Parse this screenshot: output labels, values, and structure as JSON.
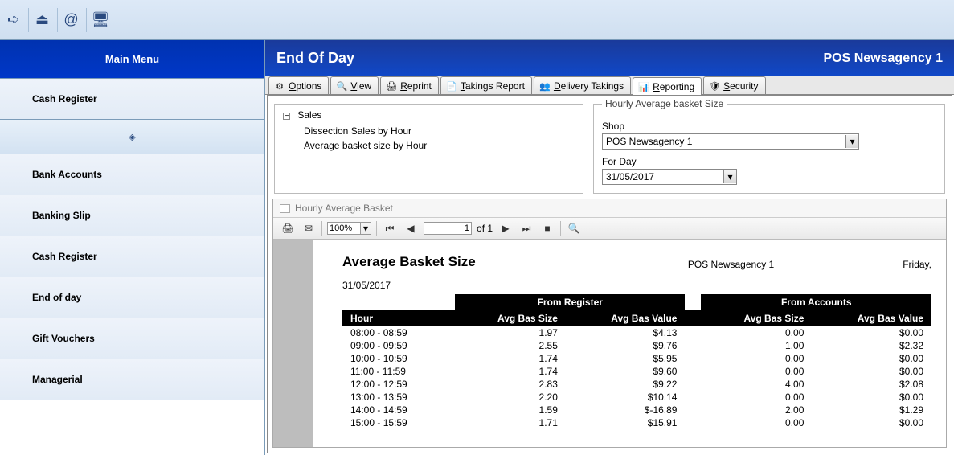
{
  "sidebar": {
    "header": "Main Menu",
    "items": [
      "Cash Register",
      "Bank Accounts",
      "Banking Slip",
      "Cash Register",
      "End of day",
      "Gift Vouchers",
      "Managerial"
    ],
    "sub_icon_name": "diamond-icon"
  },
  "page": {
    "title": "End Of Day",
    "subtitle": "POS Newsagency 1"
  },
  "tabs": [
    {
      "label": "Options"
    },
    {
      "label": "View"
    },
    {
      "label": "Reprint"
    },
    {
      "label": "Takings Report"
    },
    {
      "label": "Delivery Takings"
    },
    {
      "label": "Reporting",
      "active": true
    },
    {
      "label": "Security"
    }
  ],
  "tree": {
    "root": "Sales",
    "children": [
      "Dissection Sales by Hour",
      "Average basket size by Hour"
    ]
  },
  "filter": {
    "legend": "Hourly Average basket Size",
    "shop_label": "Shop",
    "shop_value": "POS Newsagency 1",
    "day_label": "For Day",
    "day_value": "31/05/2017"
  },
  "report": {
    "window_title": "Hourly Average Basket",
    "zoom": "100%",
    "page_current": "1",
    "page_of": "of 1",
    "title": "Average Basket Size",
    "shop": "POS Newsagency 1",
    "day_text": "Friday,",
    "date": "31/05/2017",
    "group1": "From Register",
    "group2": "From Accounts",
    "col_hour": "Hour",
    "col_size": "Avg Bas Size",
    "col_value": "Avg Bas Value",
    "rows": [
      {
        "h": "08:00 - 08:59",
        "rs": "1.97",
        "rv": "$4.13",
        "as": "0.00",
        "av": "$0.00"
      },
      {
        "h": "09:00 - 09:59",
        "rs": "2.55",
        "rv": "$9.76",
        "as": "1.00",
        "av": "$2.32"
      },
      {
        "h": "10:00 - 10:59",
        "rs": "1.74",
        "rv": "$5.95",
        "as": "0.00",
        "av": "$0.00"
      },
      {
        "h": "11:00 - 11:59",
        "rs": "1.74",
        "rv": "$9.60",
        "as": "0.00",
        "av": "$0.00"
      },
      {
        "h": "12:00 - 12:59",
        "rs": "2.83",
        "rv": "$9.22",
        "as": "4.00",
        "av": "$2.08"
      },
      {
        "h": "13:00 - 13:59",
        "rs": "2.20",
        "rv": "$10.14",
        "as": "0.00",
        "av": "$0.00"
      },
      {
        "h": "14:00 - 14:59",
        "rs": "1.59",
        "rv": "$-16.89",
        "as": "2.00",
        "av": "$1.29"
      },
      {
        "h": "15:00 - 15:59",
        "rs": "1.71",
        "rv": "$15.91",
        "as": "0.00",
        "av": "$0.00"
      }
    ]
  }
}
